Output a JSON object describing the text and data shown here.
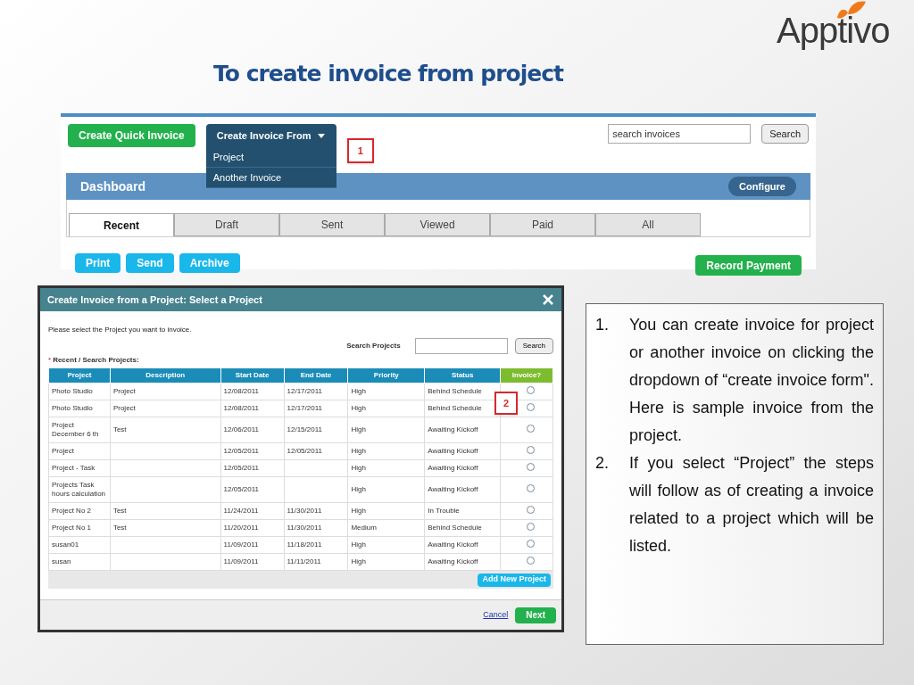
{
  "slide": {
    "title": "To create invoice from project",
    "logo": "Apptivo"
  },
  "invoices_screen": {
    "quick_button": "Create Quick Invoice",
    "dropdown": {
      "label": "Create Invoice From",
      "expanded": true,
      "items": [
        "Project",
        "Another Invoice"
      ]
    },
    "callout": "1",
    "search": {
      "placeholder": "search invoices",
      "button": "Search"
    },
    "dashboard": {
      "title": "Dashboard",
      "configure": "Configure"
    },
    "tabs": [
      {
        "label": "Recent",
        "selected": true
      },
      {
        "label": "Draft",
        "selected": false
      },
      {
        "label": "Sent",
        "selected": false
      },
      {
        "label": "Viewed",
        "selected": false
      },
      {
        "label": "Paid",
        "selected": false
      },
      {
        "label": "All",
        "selected": false
      }
    ],
    "actions": [
      "Print",
      "Send",
      "Archive"
    ],
    "record_button": "Record Payment"
  },
  "dialog": {
    "title": "Create Invoice from a Project: Select a Project",
    "instruction": "Please select the Project you want to invoice.",
    "search_label": "Search Projects",
    "search_button": "Search",
    "required_mark": "*",
    "section_label": "Recent / Search Projects:",
    "columns": [
      "Project",
      "Description",
      "Start Date",
      "End Date",
      "Priority",
      "Status",
      "Invoice?"
    ],
    "rows": [
      {
        "cells": [
          "Photo Studio",
          "Project",
          "12/08/2011",
          "12/17/2011",
          "High",
          "Behind Schedule"
        ],
        "selected": false
      },
      {
        "cells": [
          "Photo Studio",
          "Project",
          "12/08/2011",
          "12/17/2011",
          "High",
          "Behind Schedule"
        ],
        "selected": false
      },
      {
        "cells": [
          "Project December 6 th",
          "Test",
          "12/06/2011",
          "12/15/2011",
          "High",
          "Awaiting Kickoff"
        ],
        "selected": false
      },
      {
        "cells": [
          "Project",
          "",
          "12/05/2011",
          "12/05/2011",
          "High",
          "Awaiting Kickoff"
        ],
        "selected": false
      },
      {
        "cells": [
          "Project - Task",
          "",
          "12/05/2011",
          "",
          "High",
          "Awaiting Kickoff"
        ],
        "selected": false
      },
      {
        "cells": [
          "Projects Task hours calculation",
          "",
          "12/05/2011",
          "",
          "High",
          "Awaiting Kickoff"
        ],
        "selected": false
      },
      {
        "cells": [
          "Project No 2",
          "Test",
          "11/24/2011",
          "11/30/2011",
          "High",
          "In Trouble"
        ],
        "selected": false
      },
      {
        "cells": [
          "Project No 1",
          "Test",
          "11/20/2011",
          "11/30/2011",
          "Medium",
          "Behind Schedule"
        ],
        "selected": false
      },
      {
        "cells": [
          "susan01",
          "",
          "11/09/2011",
          "11/18/2011",
          "High",
          "Awaiting Kickoff"
        ],
        "selected": false
      },
      {
        "cells": [
          "susan",
          "",
          "11/09/2011",
          "11/11/2011",
          "High",
          "Awaiting Kickoff"
        ],
        "selected": false
      }
    ],
    "callout": "2",
    "add_button": "Add New Project",
    "cancel": "Cancel",
    "next": "Next"
  },
  "notes": [
    {
      "number": "1.",
      "text": "You can create invoice for project or another invoice on clicking the dropdown of “create invoice form\". Here is sample invoice from the project."
    },
    {
      "number": "2.",
      "text": "If you select “Project” the steps will follow as of creating a invoice related to a project which will be listed."
    }
  ]
}
